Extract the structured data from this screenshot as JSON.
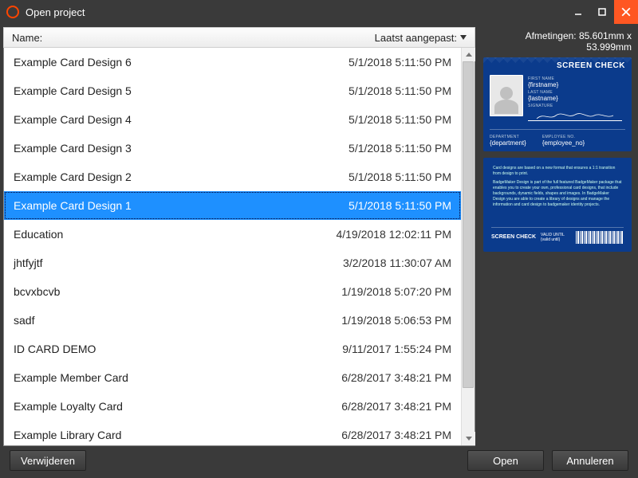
{
  "window": {
    "title": "Open project"
  },
  "columns": {
    "name": "Name:",
    "date": "Laatst aangepast:"
  },
  "selected_index": 5,
  "items": [
    {
      "name": "Example Card Design 6",
      "modified": "5/1/2018 5:11:50 PM"
    },
    {
      "name": "Example Card Design 5",
      "modified": "5/1/2018 5:11:50 PM"
    },
    {
      "name": "Example Card Design 4",
      "modified": "5/1/2018 5:11:50 PM"
    },
    {
      "name": "Example Card Design 3",
      "modified": "5/1/2018 5:11:50 PM"
    },
    {
      "name": "Example Card Design 2",
      "modified": "5/1/2018 5:11:50 PM"
    },
    {
      "name": "Example Card Design 1",
      "modified": "5/1/2018 5:11:50 PM"
    },
    {
      "name": "Education",
      "modified": "4/19/2018 12:02:11 PM"
    },
    {
      "name": "jhtfyjtf",
      "modified": "3/2/2018 11:30:07 AM"
    },
    {
      "name": "bcvxbcvb",
      "modified": "1/19/2018 5:07:20 PM"
    },
    {
      "name": "sadf",
      "modified": "1/19/2018 5:06:53 PM"
    },
    {
      "name": "ID CARD DEMO",
      "modified": "9/11/2017 1:55:24 PM"
    },
    {
      "name": "Example Member Card",
      "modified": "6/28/2017 3:48:21 PM"
    },
    {
      "name": "Example Loyalty Card",
      "modified": "6/28/2017 3:48:21 PM"
    },
    {
      "name": "Example Library Card",
      "modified": "6/28/2017 3:48:21 PM"
    }
  ],
  "preview": {
    "dimensions_label": "Afmetingen:  85.601mm  x  53.999mm",
    "card_front": {
      "brand": "SCREEN CHECK",
      "labels": {
        "first_name": "FIRST NAME",
        "last_name": "LAST NAME",
        "signature": "SIGNATURE",
        "department": "DEPARTMENT",
        "employee_no": "EMPLOYEE NO."
      },
      "values": {
        "first_name": "{firstname}",
        "last_name": "{lastname}",
        "department": "{department}",
        "employee_no": "{employee_no}"
      }
    },
    "card_back": {
      "paragraph1": "Card designs are based on a new format that ensures a 1:1 transition from design to print.",
      "paragraph2": "BadgeMaker Design is part of the full featured BadgeMaker package that enables you to create your own, professional card designs, that include backgrounds, dynamic fields, shapes and images. In BadgeMaker Design you are able to create a library of designs and manage the information and card design to badgemaker identity projects.",
      "brand": "SCREEN CHECK",
      "valid_label": "VALID UNTIL",
      "valid_value": "{valid until}"
    }
  },
  "buttons": {
    "delete": "Verwijderen",
    "open": "Open",
    "cancel": "Annuleren"
  }
}
